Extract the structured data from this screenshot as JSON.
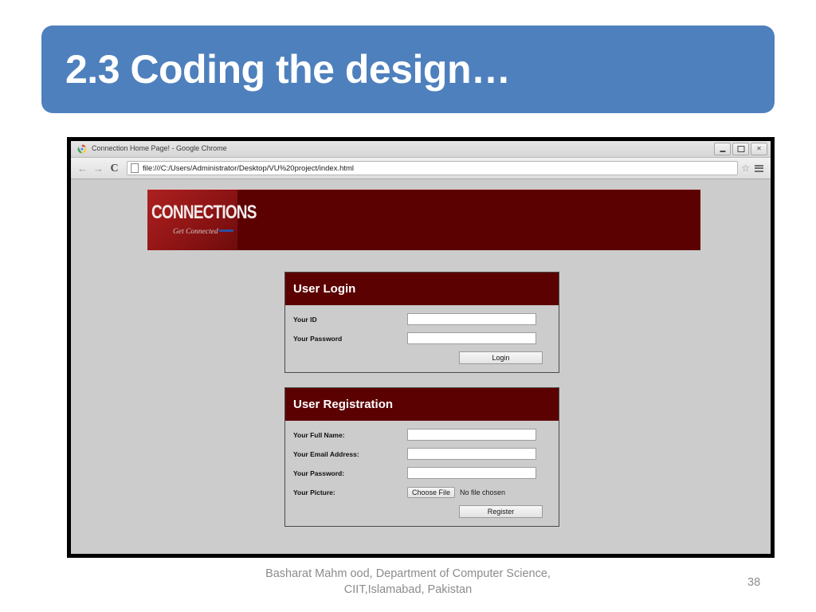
{
  "slide": {
    "title": "2.3 Coding the design…",
    "title_bar_color": "#4e80bd",
    "page_number": "38",
    "footer_line1": "Basharat Mahm ood, Department of",
    "footer_line2": "Computer Science, CIIT,Islamabad, Pakistan"
  },
  "browser": {
    "favicon": "chrome-logo-icon",
    "tab_title": "Connection Home Page! - Google Chrome",
    "window_controls": {
      "minimize": "minimize-icon",
      "maximize": "maximize-icon",
      "close": "✕"
    },
    "toolbar": {
      "back": "←",
      "forward": "→",
      "reload": "C",
      "url": "file:///C:/Users/Administrator/Desktop/VU%20project/index.html",
      "star": "☆",
      "menu": "hamburger-menu-icon"
    }
  },
  "site": {
    "banner_color": "#5c0101",
    "logo_color": "#a01c1c",
    "logo_word": "CONNECTIONS",
    "logo_tagline": "Get Connected"
  },
  "login_panel": {
    "heading": "User Login",
    "fields": [
      {
        "label": "Your ID",
        "value": ""
      },
      {
        "label": "Your Password",
        "value": ""
      }
    ],
    "submit_label": "Login"
  },
  "registration_panel": {
    "heading": "User Registration",
    "fields": [
      {
        "label": "Your Full Name:",
        "value": ""
      },
      {
        "label": "Your Email Address:",
        "value": ""
      },
      {
        "label": "Your Password:",
        "value": ""
      }
    ],
    "picture_label": "Your Picture:",
    "file_button_label": "Choose File",
    "file_status": "No file chosen",
    "submit_label": "Register"
  }
}
